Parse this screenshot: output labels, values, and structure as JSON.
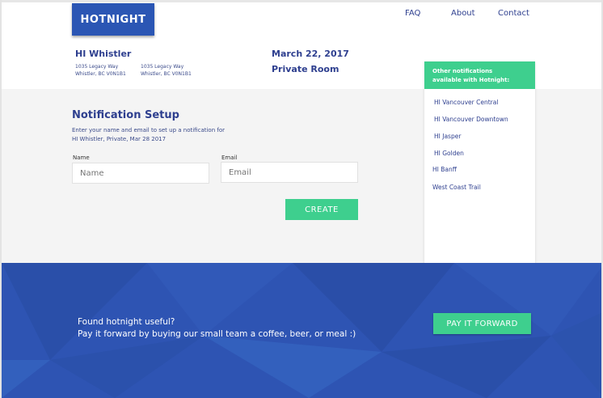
{
  "header": {
    "logo": "HOTNIGHT",
    "nav": [
      "FAQ",
      "About",
      "Contact"
    ]
  },
  "hotel": {
    "name": "HI Whistler",
    "address_1": [
      "1035 Legacy Way",
      "Whistler, BC V0N1B1"
    ],
    "address_2": [
      "1035 Legacy Way",
      "Whistler, BC V0N1B1"
    ],
    "date": "March 22, 2017",
    "room": "Private Room"
  },
  "setup": {
    "title": "Notification Setup",
    "desc_line1": "Enter your name and email to set up a notification for",
    "desc_line2": "HI Whistler, Private, Mar 28 2017",
    "name_label": "Name",
    "name_placeholder": "Name",
    "email_label": "Email",
    "email_placeholder": "Email",
    "create_label": "CREATE"
  },
  "side": {
    "heading_line1": "Other notifications",
    "heading_line2": "available with Hotnight:",
    "items": [
      "HI Vancouver Central",
      "HI Vancouver Downtown",
      "HI Jasper",
      "HI Golden",
      "HI Banff",
      "West Coast Trail"
    ]
  },
  "footer": {
    "line1": "Found hotnight useful?",
    "line2": "Pay it forward by buying our small team a coffee, beer, or meal :)",
    "button": "PAY IT FORWARD"
  },
  "colors": {
    "brand_blue": "#2b56b4",
    "accent_green": "#3ecf8e",
    "text_navy": "#2e3f8f"
  }
}
